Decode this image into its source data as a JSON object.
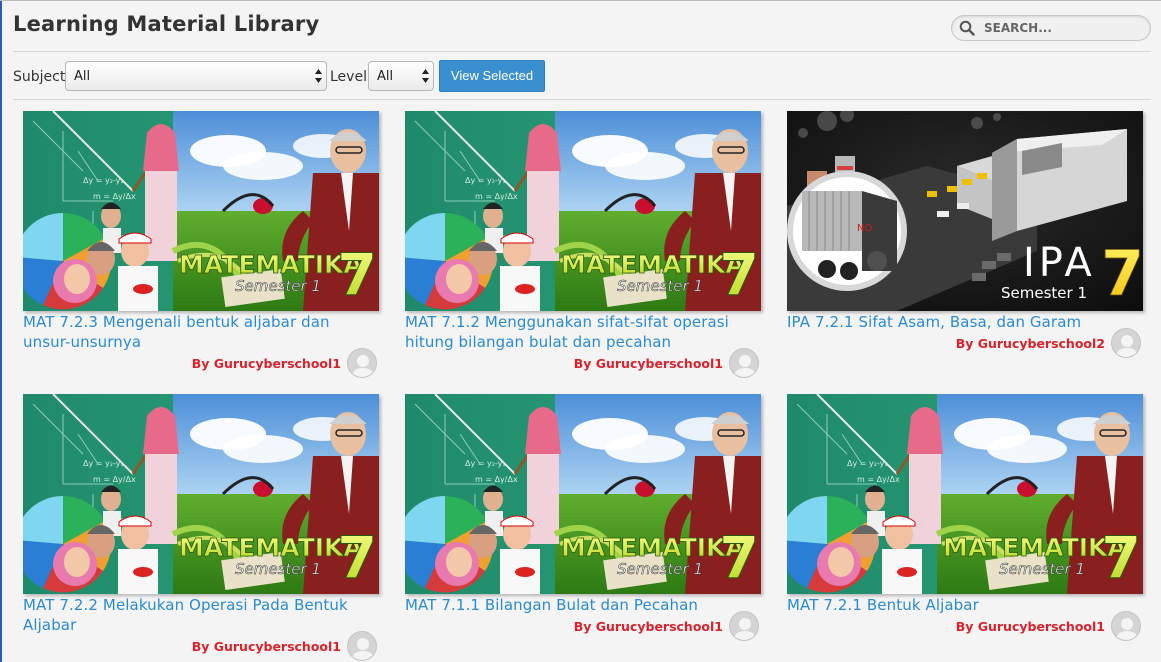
{
  "page": {
    "title": "Learning Material Library"
  },
  "search": {
    "placeholder": "SEARCH..."
  },
  "filters": {
    "subject_label": "Subject",
    "subject_value": "All",
    "level_label": "Level",
    "level_value": "All",
    "view_button": "View Selected"
  },
  "thumbnails": {
    "mat_brand": "MATEMATIKA",
    "mat_semester": "Semester 1",
    "mat_grade": "7",
    "ipa_brand": "IPA",
    "ipa_semester": "Semester 1",
    "ipa_grade": "7",
    "ipa_chem": "NO"
  },
  "materials": [
    {
      "title": "MAT 7.2.3 Mengenali bentuk aljabar dan unsur-unsurnya",
      "author": "By Gurucyberschool1",
      "subject": "MAT"
    },
    {
      "title": "MAT 7.1.2 Menggunakan sifat-sifat operasi hitung bilangan bulat dan pecahan",
      "author": "By Gurucyberschool1",
      "subject": "MAT"
    },
    {
      "title": "IPA 7.2.1 Sifat Asam, Basa, dan Garam",
      "author": "By Gurucyberschool2",
      "subject": "IPA"
    },
    {
      "title": "MAT 7.2.2 Melakukan Operasi Pada Bentuk Aljabar",
      "author": "By Gurucyberschool1",
      "subject": "MAT"
    },
    {
      "title": "MAT 7.1.1 Bilangan Bulat dan Pecahan",
      "author": "By Gurucyberschool1",
      "subject": "MAT"
    },
    {
      "title": "MAT 7.2.1 Bentuk Aljabar",
      "author": "By Gurucyberschool1",
      "subject": "MAT"
    }
  ],
  "colors": {
    "title_link": "#2a8bd3",
    "author": "#d9232d",
    "button": "#3a8fd0"
  }
}
